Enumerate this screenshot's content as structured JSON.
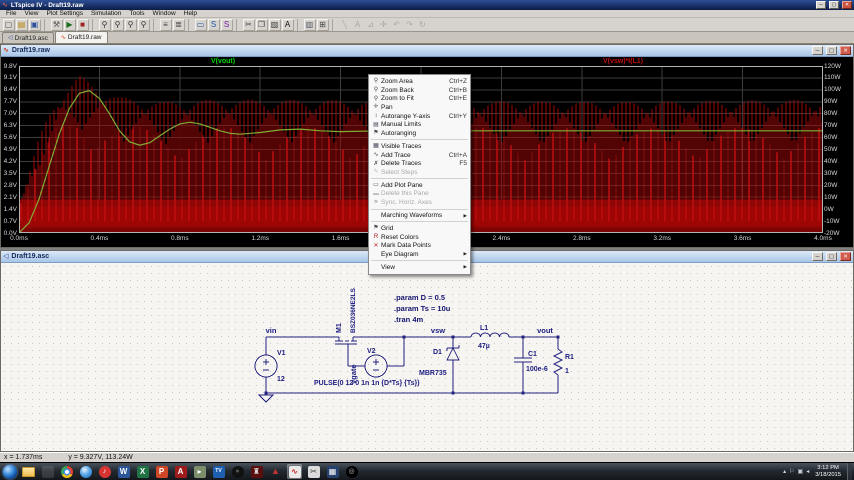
{
  "window": {
    "title": "LTspice IV - Draft19.raw"
  },
  "icons": {
    "minimize": "─",
    "maximize": "▢",
    "close": "✕",
    "submenu": "▶",
    "waveform": "∿",
    "schematic": "◁",
    "zoom-area": "⚲",
    "zoom-back": "⚲",
    "zoom-fit": "⚲",
    "pan": "✛",
    "autorange": "↕",
    "manual-limits": "▤",
    "flag": "⚑",
    "visible-traces": "▦",
    "add-trace": "∿",
    "delete-traces": "✗",
    "select-steps": "✎",
    "add-pane": "▭",
    "delete-pane": "▬",
    "reset-colors": "R",
    "mark-points": "✕",
    "tray-expand": "▴"
  },
  "menu_bar": [
    "File",
    "View",
    "Plot Settings",
    "Simulation",
    "Tools",
    "Window",
    "Help"
  ],
  "toolbar": [
    {
      "name": "new-schematic",
      "glyph": "▢",
      "color": "#555"
    },
    {
      "name": "open",
      "glyph": "▤",
      "color": "#b8860b"
    },
    {
      "name": "save",
      "glyph": "▣",
      "color": "#2e4f9e"
    },
    {
      "sep": true
    },
    {
      "name": "control-panel",
      "glyph": "⚒",
      "color": "#555"
    },
    {
      "name": "run",
      "glyph": "▶",
      "color": "#1e6e1e"
    },
    {
      "name": "halt",
      "glyph": "■",
      "color": "#a02020"
    },
    {
      "sep": true
    },
    {
      "name": "zoom-in",
      "glyph": "⚲",
      "color": "#333"
    },
    {
      "name": "zoom-out",
      "glyph": "⚲",
      "color": "#333"
    },
    {
      "name": "zoom-full",
      "glyph": "⚲",
      "color": "#333"
    },
    {
      "name": "zoom-back",
      "glyph": "⚲",
      "color": "#333"
    },
    {
      "sep": true
    },
    {
      "name": "netlist",
      "glyph": "≡",
      "color": "#444"
    },
    {
      "name": "spice-error-log",
      "glyph": "≣",
      "color": "#444"
    },
    {
      "sep": true
    },
    {
      "name": "plot-pane",
      "glyph": "▭",
      "color": "#2255aa"
    },
    {
      "name": "step",
      "glyph": "S",
      "color": "#2255aa"
    },
    {
      "name": "steps",
      "glyph": "S",
      "color": "#7722aa"
    },
    {
      "sep": true
    },
    {
      "name": "cut",
      "glyph": "✂",
      "color": "#444"
    },
    {
      "name": "copy",
      "glyph": "❐",
      "color": "#444"
    },
    {
      "name": "paste",
      "glyph": "▨",
      "color": "#444"
    },
    {
      "name": "find",
      "glyph": "A",
      "color": "#111"
    },
    {
      "sep": true
    },
    {
      "name": "print-preview",
      "glyph": "▥",
      "color": "#556"
    },
    {
      "name": "print",
      "glyph": "⊞",
      "color": "#444"
    },
    {
      "sep": true
    },
    {
      "name": "edit-wire",
      "glyph": "╲",
      "disabled": true
    },
    {
      "name": "edit-label",
      "glyph": "A",
      "disabled": true
    },
    {
      "name": "edit-component",
      "glyph": "⊿",
      "disabled": true
    },
    {
      "name": "edit-move",
      "glyph": "✛",
      "disabled": true
    },
    {
      "name": "edit-undo",
      "glyph": "↶",
      "disabled": true
    },
    {
      "name": "edit-redo",
      "glyph": "↷",
      "disabled": true
    },
    {
      "name": "edit-rotate",
      "glyph": "↻",
      "disabled": true
    }
  ],
  "tabs": [
    {
      "label": "Draft19.asc",
      "icon": "schematic",
      "active": false
    },
    {
      "label": "Draft19.raw",
      "icon": "waveform",
      "active": true
    }
  ],
  "plot_window": {
    "title": "Draft19.raw",
    "traces": [
      {
        "label": "V(vout)",
        "color": "#00d800"
      },
      {
        "label": "V(vsw)*I(L1)",
        "color": "#c01010"
      }
    ],
    "y_left_ticks": [
      "9.8V",
      "9.1V",
      "8.4V",
      "7.7V",
      "7.0V",
      "6.3V",
      "5.6V",
      "4.9V",
      "4.2V",
      "3.5V",
      "2.8V",
      "2.1V",
      "1.4V",
      "0.7V",
      "0.0V"
    ],
    "y_right_ticks": [
      "120W",
      "110W",
      "100W",
      "90W",
      "80W",
      "70W",
      "60W",
      "50W",
      "40W",
      "30W",
      "20W",
      "10W",
      "0W",
      "-10W",
      "-20W"
    ],
    "x_ticks": [
      "0.0ms",
      "0.4ms",
      "0.8ms",
      "1.2ms",
      "1.6ms",
      "2.0ms",
      "2.4ms",
      "2.8ms",
      "3.2ms",
      "3.6ms",
      "4.0ms"
    ]
  },
  "chart_data": {
    "type": "line",
    "x_unit": "ms",
    "x_range": [
      0,
      4.0
    ],
    "y_left_unit": "V",
    "y_left_range": [
      0,
      9.8
    ],
    "y_right_unit": "W",
    "y_right_range": [
      -20,
      120
    ],
    "grid": true,
    "series": [
      {
        "name": "V(vout)",
        "axis": "left",
        "color": "#7fae35",
        "points": [
          [
            0,
            0
          ],
          [
            0.05,
            0.6
          ],
          [
            0.1,
            2.0
          ],
          [
            0.15,
            3.9
          ],
          [
            0.2,
            5.8
          ],
          [
            0.25,
            7.3
          ],
          [
            0.3,
            8.2
          ],
          [
            0.35,
            8.35
          ],
          [
            0.4,
            7.9
          ],
          [
            0.45,
            7.0
          ],
          [
            0.5,
            6.0
          ],
          [
            0.55,
            5.35
          ],
          [
            0.6,
            5.15
          ],
          [
            0.65,
            5.3
          ],
          [
            0.7,
            5.7
          ],
          [
            0.75,
            6.1
          ],
          [
            0.8,
            6.4
          ],
          [
            0.85,
            6.5
          ],
          [
            0.9,
            6.4
          ],
          [
            0.95,
            6.2
          ],
          [
            1.0,
            6.0
          ],
          [
            1.05,
            5.85
          ],
          [
            1.1,
            5.8
          ],
          [
            1.2,
            5.9
          ],
          [
            1.3,
            6.05
          ],
          [
            1.4,
            6.1
          ],
          [
            1.5,
            6.0
          ],
          [
            1.6,
            5.95
          ],
          [
            1.8,
            6.0
          ],
          [
            2.0,
            6.0
          ],
          [
            4.0,
            6.0
          ]
        ]
      },
      {
        "name": "V(vsw)*I(L1)",
        "axis": "right",
        "color": "#a40808",
        "style": "dense-switching",
        "envelope_top_W": [
          [
            0,
            2
          ],
          [
            0.05,
            30
          ],
          [
            0.1,
            60
          ],
          [
            0.15,
            80
          ],
          [
            0.2,
            96
          ],
          [
            0.3,
            112
          ],
          [
            0.4,
            102
          ],
          [
            0.5,
            94
          ],
          [
            0.7,
            90
          ],
          [
            1.0,
            92
          ],
          [
            2.0,
            91
          ],
          [
            3.0,
            90
          ],
          [
            4.0,
            92
          ]
        ],
        "band_W": [
          -20,
          8
        ]
      }
    ]
  },
  "context_menu": {
    "items": [
      {
        "label": "Zoom Area",
        "shortcut": "Ctrl+Z",
        "icon": "zoom-area"
      },
      {
        "label": "Zoom Back",
        "shortcut": "Ctrl+B",
        "icon": "zoom-back"
      },
      {
        "label": "Zoom to Fit",
        "shortcut": "Ctrl+E",
        "icon": "zoom-fit"
      },
      {
        "label": "Pan",
        "icon": "pan"
      },
      {
        "label": "Autorange Y-axis",
        "shortcut": "Ctrl+Y",
        "icon": "autorange"
      },
      {
        "label": "Manual Limits",
        "icon": "manual-limits"
      },
      {
        "label": "Autoranging",
        "icon": "flag"
      },
      {
        "sep": true
      },
      {
        "label": "Visible Traces",
        "icon": "visible-traces"
      },
      {
        "label": "Add Trace",
        "shortcut": "Ctrl+A",
        "icon": "add-trace"
      },
      {
        "label": "Delete Traces",
        "shortcut": "F5",
        "icon": "delete-traces"
      },
      {
        "label": "Select Steps",
        "icon": "select-steps",
        "disabled": true
      },
      {
        "sep": true
      },
      {
        "label": "Add Plot Pane",
        "icon": "add-pane"
      },
      {
        "label": "Delete this Pane",
        "icon": "delete-pane",
        "disabled": true
      },
      {
        "label": "Sync. Horiz. Axes",
        "icon": "flag",
        "disabled": true
      },
      {
        "sep": true
      },
      {
        "label": "Marching Waveforms",
        "submenu": true
      },
      {
        "sep": true
      },
      {
        "label": "Grid",
        "icon": "flag"
      },
      {
        "label": "Reset Colors",
        "icon": "reset-colors",
        "icon_color": "#b02020"
      },
      {
        "label": "Mark Data Points",
        "icon": "mark-points",
        "icon_color": "#c02020"
      },
      {
        "label": "Eye Diagram",
        "submenu": true
      },
      {
        "sep": true
      },
      {
        "label": "View",
        "submenu": true
      }
    ]
  },
  "schematic_window": {
    "title": "Draft19.asc",
    "directives": [
      ".param D = 0.5",
      ".param Ts = 10u",
      ".tran 4m"
    ],
    "nets": {
      "vin": "vin",
      "vsw": "vsw",
      "vout": "vout",
      "vgate": "vgate"
    },
    "v1": {
      "name": "V1",
      "value": "12"
    },
    "v2": {
      "name": "V2",
      "value": "PULSE(0 12 0 1n 1n {D*Ts} {Ts})"
    },
    "m1": {
      "name": "M1",
      "value": "BSZ036NE2LS"
    },
    "d1": {
      "name": "D1",
      "value": "MBR735"
    },
    "l1": {
      "name": "L1",
      "value": "47µ"
    },
    "c1": {
      "name": "C1",
      "value": "100e-6"
    },
    "r1": {
      "name": "R1",
      "value": "1"
    }
  },
  "status_bar": {
    "x": "x = 1.737ms",
    "y": "y = 9.327V, 113.24W"
  },
  "taskbar": {
    "items": [
      {
        "name": "start-button",
        "kind": "orb"
      },
      {
        "name": "explorer",
        "kind": "folder"
      },
      {
        "name": "ghost-app",
        "kind": "ghost"
      },
      {
        "name": "chrome",
        "kind": "chrome"
      },
      {
        "name": "google-earth",
        "kind": "earth"
      },
      {
        "name": "itunes",
        "kind": "circle",
        "bg": "#d63333",
        "glyph": "♪",
        "fg": "#fff"
      },
      {
        "name": "word",
        "kind": "square",
        "bg": "#2b579a",
        "glyph": "W",
        "fg": "#fff"
      },
      {
        "name": "excel",
        "kind": "square",
        "bg": "#217346",
        "glyph": "X",
        "fg": "#fff"
      },
      {
        "name": "powerpoint",
        "kind": "square",
        "bg": "#d04727",
        "glyph": "P",
        "fg": "#fff"
      },
      {
        "name": "acrobat",
        "kind": "square",
        "bg": "#a01c1c",
        "glyph": "A",
        "fg": "#fff"
      },
      {
        "name": "movie-app",
        "kind": "square",
        "bg": "#7d8f6a",
        "glyph": "▸",
        "fg": "#fff"
      },
      {
        "name": "tv-app",
        "kind": "square",
        "bg": "#1f5fb0",
        "glyph": "TV",
        "fg": "#fff",
        "small": true
      },
      {
        "name": "disc-app",
        "kind": "circle",
        "bg": "#111",
        "glyph": "●",
        "fg": "#555"
      },
      {
        "name": "game-app",
        "kind": "square",
        "bg": "#5a0f0f",
        "glyph": "♜",
        "fg": "#ddd"
      },
      {
        "name": "triangle-app",
        "kind": "tri",
        "glyph": "▲"
      },
      {
        "name": "ltspice",
        "kind": "square",
        "bg": "#e9e9e9",
        "glyph": "∿",
        "fg": "#c22",
        "active": true
      },
      {
        "name": "snipping-tool",
        "kind": "square",
        "bg": "#dcdcdc",
        "glyph": "✂",
        "fg": "#444"
      },
      {
        "name": "calculator",
        "kind": "square",
        "bg": "#27406e",
        "glyph": "▦",
        "fg": "#fff"
      },
      {
        "name": "media-disc",
        "kind": "circle",
        "bg": "#000",
        "glyph": "◎",
        "fg": "#bbb"
      }
    ],
    "tray_icons": [
      "⚐",
      "▣",
      "◂"
    ],
    "clock": {
      "time": "3:12 PM",
      "date": "3/18/2015"
    }
  }
}
